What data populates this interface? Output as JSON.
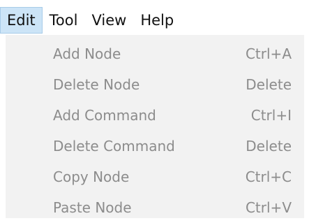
{
  "menubar": {
    "items": [
      {
        "label": "Edit"
      },
      {
        "label": "Tool"
      },
      {
        "label": "View"
      },
      {
        "label": "Help"
      }
    ]
  },
  "dropdown": {
    "items": [
      {
        "label": "Add Node",
        "shortcut": "Ctrl+A"
      },
      {
        "label": "Delete Node",
        "shortcut": "Delete"
      },
      {
        "label": "Add Command",
        "shortcut": "Ctrl+I"
      },
      {
        "label": "Delete Command",
        "shortcut": "Delete"
      },
      {
        "label": "Copy Node",
        "shortcut": "Ctrl+C"
      },
      {
        "label": "Paste Node",
        "shortcut": "Ctrl+V"
      }
    ]
  },
  "colors": {
    "active_menu_bg": "#cce4f7",
    "active_menu_border": "#a8cbe8",
    "dropdown_bg": "#f2f2f2",
    "disabled_text": "#8c8c8c"
  }
}
